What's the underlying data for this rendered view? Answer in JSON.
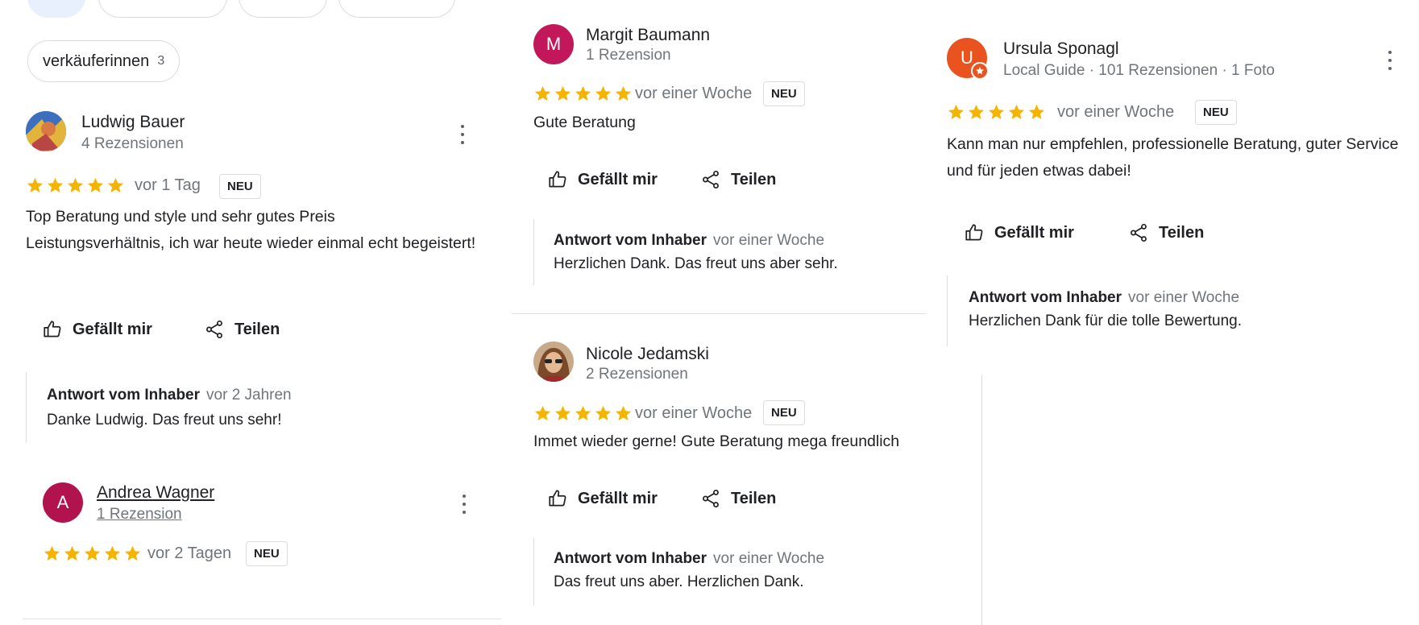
{
  "colors": {
    "star": "#f4b400",
    "neu_border": "#dadce0",
    "link": "#1a0dab"
  },
  "filter_chip": {
    "label": "verkäuferinnen",
    "count": "3"
  },
  "actions": {
    "like": "Gefällt mir",
    "share": "Teilen"
  },
  "badge_label": "NEU",
  "reply_label": "Antwort vom Inhaber",
  "reviews": [
    {
      "name": "Ludwig Bauer",
      "meta": "4 Rezensionen",
      "rating": 5,
      "when": "vor 1 Tag",
      "text": "Top Beratung und style und sehr gutes Preis Leistungsverhältnis, ich war heute wieder einmal echt begeistert!",
      "reply_time": "vor 2 Jahren",
      "reply_text": "Danke Ludwig. Das freut uns sehr!",
      "avatar_icon": "photo-avatar"
    },
    {
      "name": "Andrea Wagner",
      "meta": "1 Rezension",
      "rating": 5,
      "when": "vor 2 Tagen",
      "avatar_letter": "A",
      "avatar_color": "#b0134d"
    },
    {
      "name": "Margit Baumann",
      "meta": "1 Rezension",
      "rating": 5,
      "when": "vor einer Woche",
      "text": "Gute Beratung",
      "reply_time": "vor einer Woche",
      "reply_text": "Herzlichen Dank. Das freut uns aber sehr.",
      "avatar_letter": "M",
      "avatar_color": "#c2185b"
    },
    {
      "name": "Nicole Jedamski",
      "meta": "2 Rezensionen",
      "rating": 5,
      "when": "vor einer Woche",
      "text": "Immet wieder gerne! Gute Beratung mega freundlich",
      "reply_time": "vor einer Woche",
      "reply_text": "Das freut uns aber. Herzlichen Dank.",
      "avatar_icon": "photo-avatar"
    },
    {
      "name": "Ursula Sponagl",
      "meta": "Local Guide · 101 Rezensionen · 1 Foto",
      "rating": 5,
      "when": "vor einer Woche",
      "text": "Kann man nur empfehlen, professionelle Beratung, guter Service und für jeden etwas dabei!",
      "reply_time": "vor einer Woche",
      "reply_text": "Herzlichen Dank für die tolle Bewertung.",
      "avatar_letter": "U",
      "avatar_color": "#e8531f"
    }
  ]
}
